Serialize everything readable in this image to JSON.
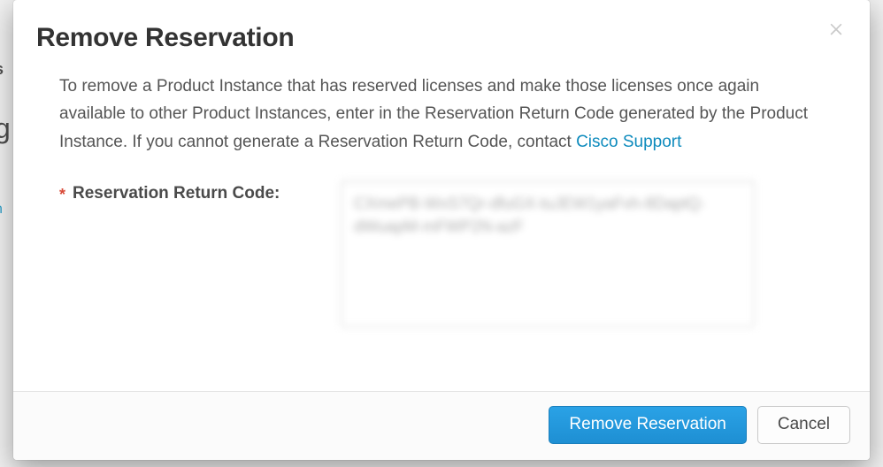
{
  "modal": {
    "title": "Remove Reservation",
    "description_prefix": "To remove a Product Instance that has reserved licenses and make those licenses once again available to other Product Instances, enter in the Reservation Return Code generated by the Product Instance. If you cannot generate a Reservation Return Code, contact ",
    "support_link_text": "Cisco Support",
    "form": {
      "required_mark": "*",
      "return_code_label": "Reservation Return Code:",
      "return_code_value": "CXmePB-WxS7Qr-dfuGX-tuJEW1yaFvh-8DaptQ-dWuapM-mFWP2N-azF"
    },
    "footer": {
      "primary_label": "Remove Reservation",
      "cancel_label": "Cancel"
    }
  }
}
